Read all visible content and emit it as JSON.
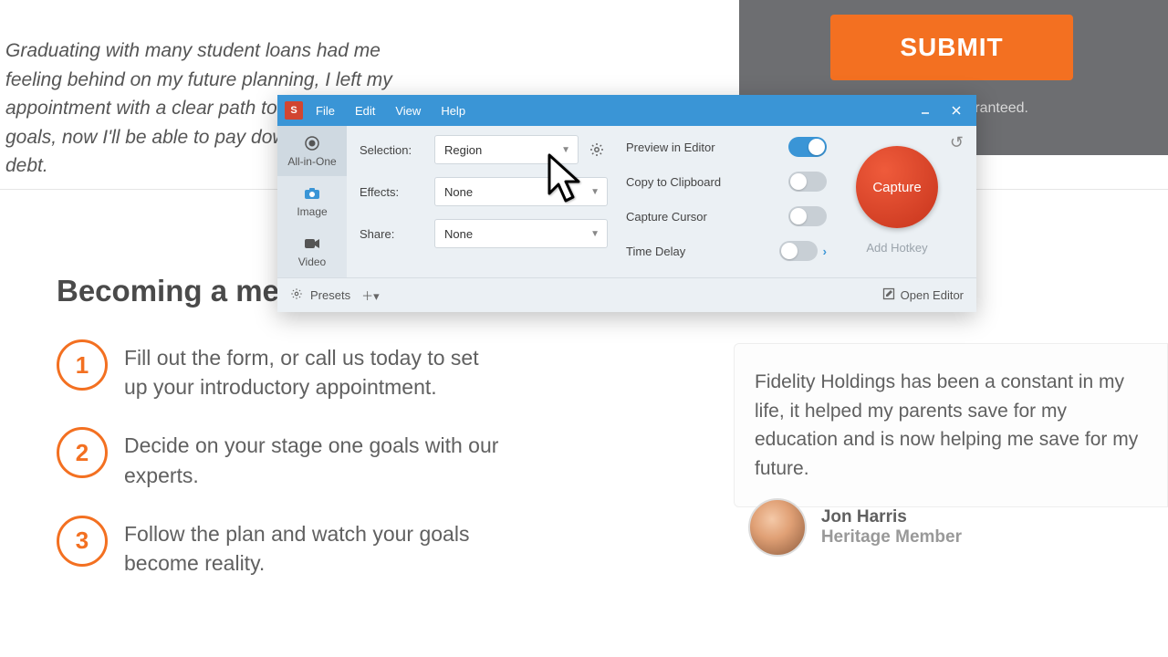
{
  "page": {
    "quote_top": "Graduating with many student loans had me feeling behind on my future planning, I left my appointment with a clear path to my retirement goals, now I'll be able to pay down my educational debt.",
    "submit_label": "SUBMIT",
    "guarantee_text": "aranteed.",
    "becoming_heading": "Becoming a member",
    "steps": [
      {
        "num": "1",
        "text": "Fill out the form, or call us today to set up your introductory appointment."
      },
      {
        "num": "2",
        "text": "Decide on your stage one goals with our experts."
      },
      {
        "num": "3",
        "text": "Follow the plan and watch your goals become reality."
      }
    ],
    "testimonial": "Fidelity Holdings has been a constant in my life, it helped my parents save for my education and is now helping me save for my future.",
    "person_name": "Jon Harris",
    "person_role": "Heritage Member"
  },
  "snagit": {
    "menu": {
      "file": "File",
      "edit": "Edit",
      "view": "View",
      "help": "Help"
    },
    "logo_letter": "S",
    "modes": {
      "all": "All-in-One",
      "image": "Image",
      "video": "Video"
    },
    "settings": {
      "selection_label": "Selection:",
      "selection_value": "Region",
      "effects_label": "Effects:",
      "effects_value": "None",
      "share_label": "Share:",
      "share_value": "None"
    },
    "toggles": {
      "preview": "Preview in Editor",
      "clipboard": "Copy to Clipboard",
      "cursor": "Capture Cursor",
      "delay": "Time Delay"
    },
    "capture_label": "Capture",
    "add_hotkey": "Add Hotkey",
    "presets": "Presets",
    "open_editor": "Open Editor"
  }
}
